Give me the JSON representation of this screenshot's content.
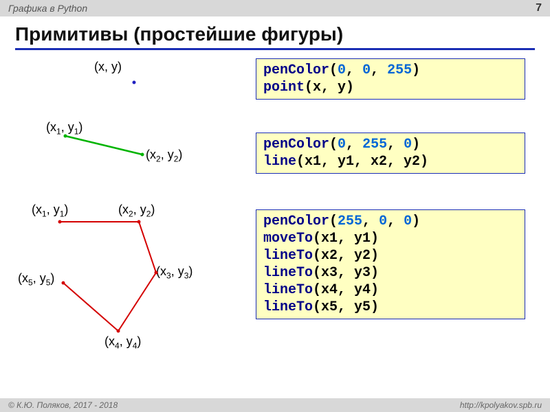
{
  "header": {
    "title": "Графика в Python",
    "page": "7"
  },
  "title": "Примитивы (простейшие фигуры)",
  "labels": {
    "pt": "(x, y)",
    "l1a": "(x",
    "l1as": "1",
    "l1b": ", y",
    "l1bs": "1",
    "l1c": ")",
    "l2a": "(x",
    "l2as": "2",
    "l2b": ", y",
    "l2bs": "2",
    "l2c": ")",
    "p1a": "(x",
    "p1as": "1",
    "p1b": ", y",
    "p1bs": "1",
    "p1c": ")",
    "p2a": "(x",
    "p2as": "2",
    "p2b": ", y",
    "p2bs": "2",
    "p2c": ")",
    "p3a": "(x",
    "p3as": "3",
    "p3b": ", y",
    "p3bs": "3",
    "p3c": ")",
    "p4a": "(x",
    "p4as": "4",
    "p4b": ", y",
    "p4bs": "4",
    "p4c": ")",
    "p5a": "(x",
    "p5as": "5",
    "p5b": ", y",
    "p5bs": "5",
    "p5c": ")"
  },
  "code1": {
    "fn1": "penColor",
    "o1": "(",
    "n1": "0",
    "c1": ", ",
    "n2": "0",
    "c2": ", ",
    "n3": "255",
    "cl1": ")",
    "fn2": "point",
    "o2": "(x, y)"
  },
  "code2": {
    "fn1": "penColor",
    "o1": "(",
    "n1": "0",
    "c1": ", ",
    "n2": "255",
    "c2": ", ",
    "n3": "0",
    "cl1": ")",
    "fn2": "line",
    "o2": "(x1, y1, x2, y2)"
  },
  "code3": {
    "fn1": "penColor",
    "o1": "(",
    "n1": "255",
    "c1": ", ",
    "n2": "0",
    "c2": ", ",
    "n3": "0",
    "cl1": ")",
    "fn2": "moveTo",
    "a2": "(x1, y1)",
    "fn3": "lineTo",
    "a3": "(x2, y2)",
    "fn4": "lineTo",
    "a4": "(x3, y3)",
    "fn5": "lineTo",
    "a5": "(x4, y4)",
    "fn6": "lineTo",
    "a6": "(x5, y5)"
  },
  "footer": {
    "left": "© К.Ю. Поляков, 2017 - 2018",
    "right": "http://kpolyakov.spb.ru"
  }
}
